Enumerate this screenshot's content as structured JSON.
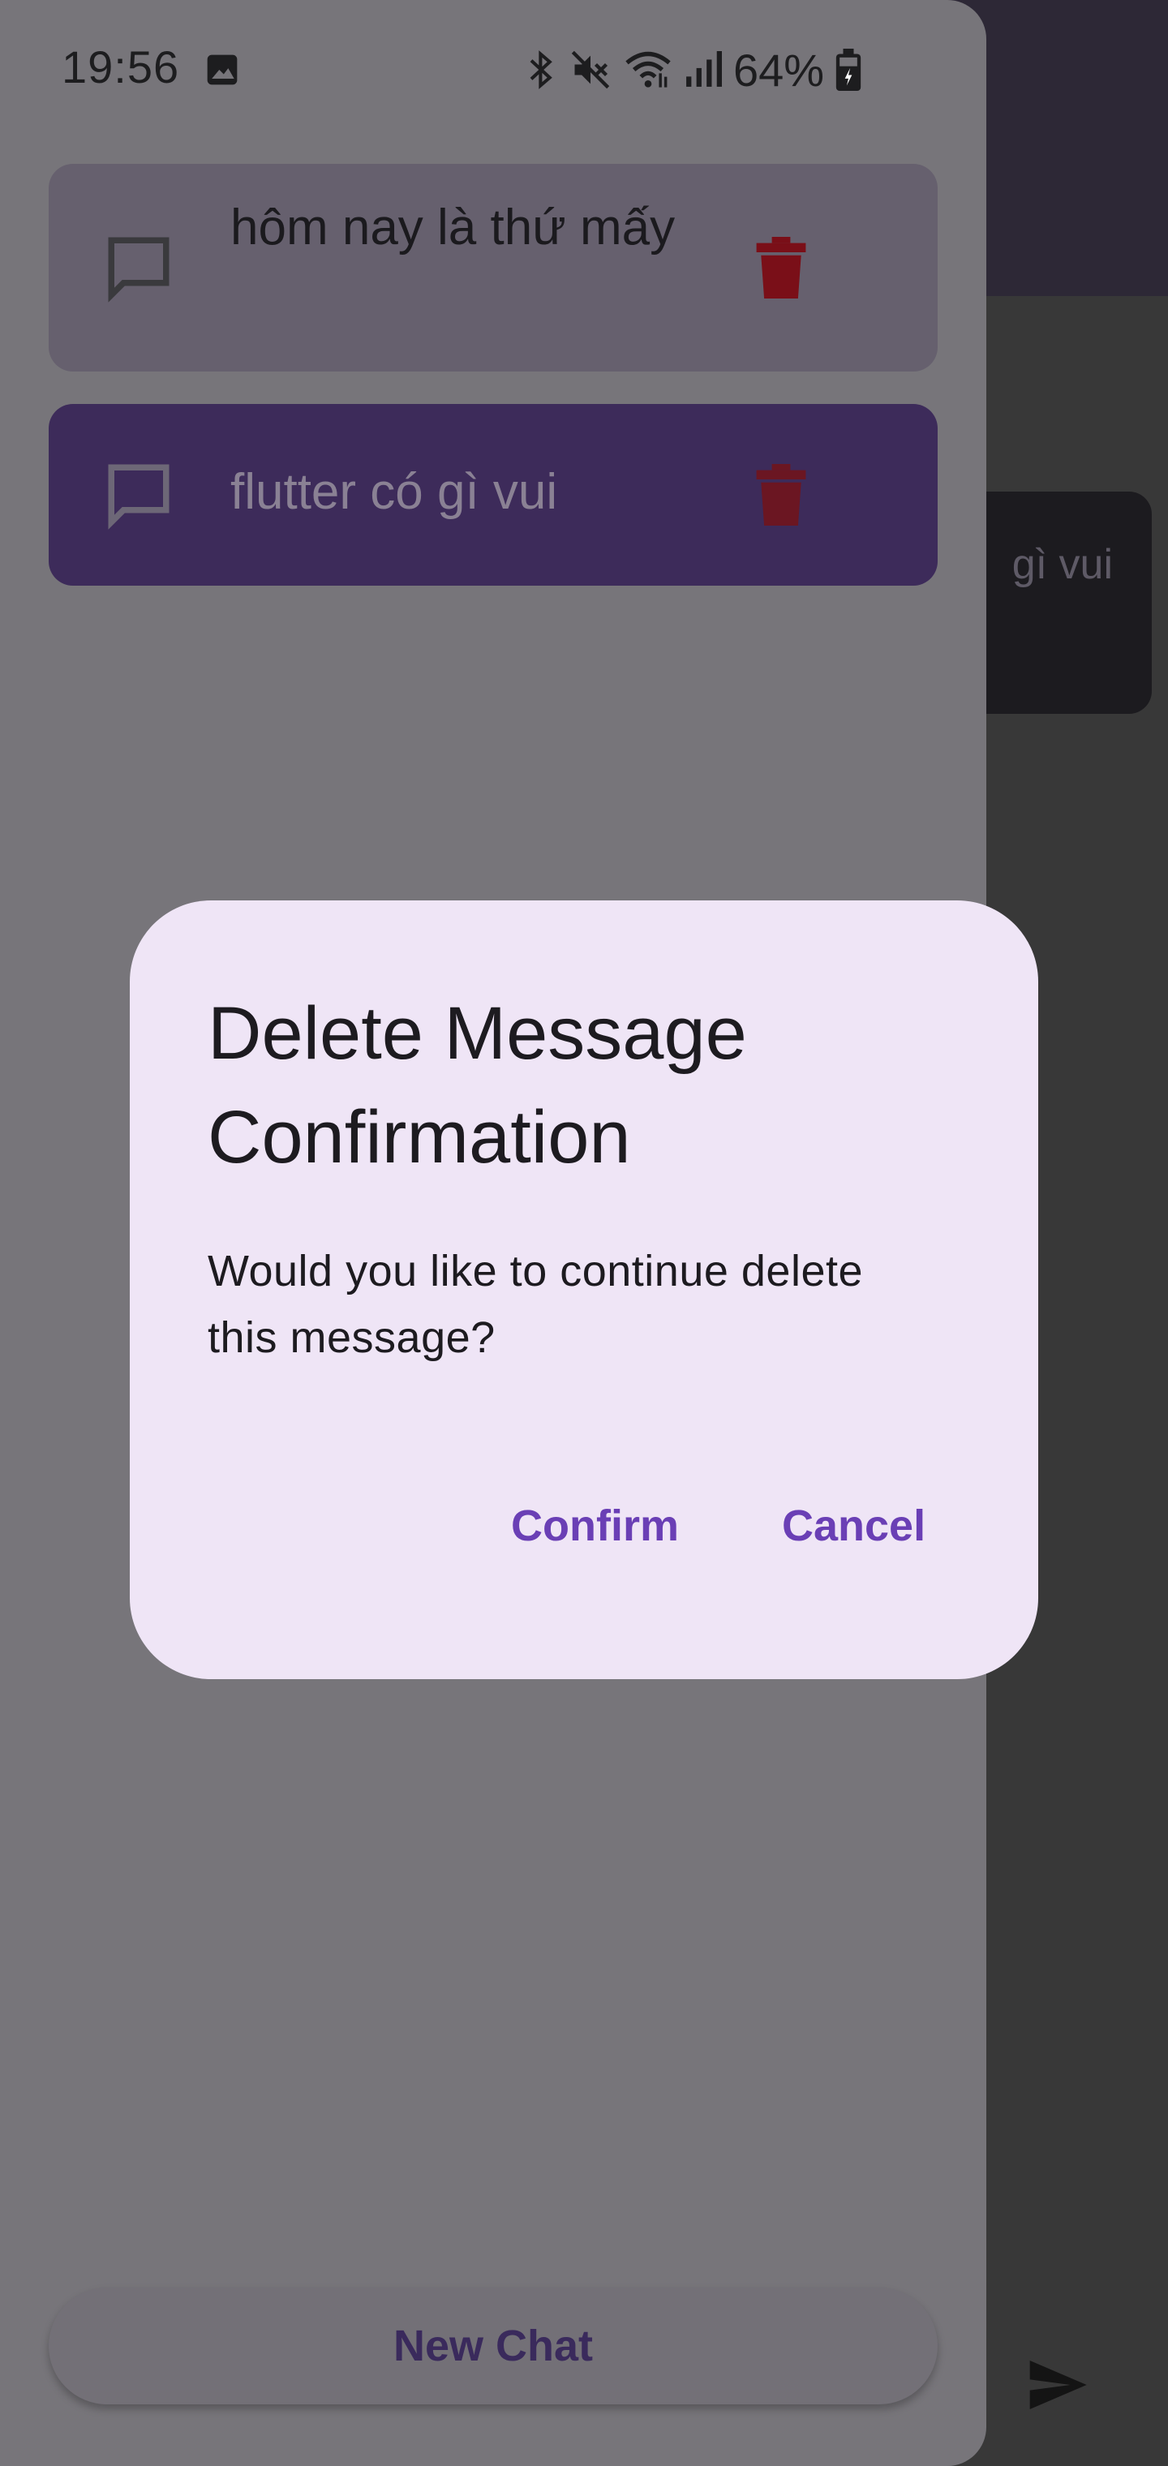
{
  "status_bar": {
    "time": "19:56",
    "battery": "64%",
    "icons": [
      "photo-icon",
      "bluetooth-icon",
      "mute-icon",
      "wifi-icon",
      "signal-icon",
      "battery-icon"
    ]
  },
  "drawer": {
    "chats": [
      {
        "label": "hôm nay là thứ mấy",
        "icon": "chat-bubble-icon",
        "action_icon": "trash-icon"
      },
      {
        "label": "flutter có gì vui",
        "icon": "chat-bubble-icon",
        "action_icon": "trash-icon"
      }
    ],
    "new_chat_label": "New Chat"
  },
  "background": {
    "bubble_text": "gì vui",
    "send_icon": "send-icon"
  },
  "dialog": {
    "title": "Delete Message Confirmation",
    "body": "Would you like to continue delete this message?",
    "confirm_label": "Confirm",
    "cancel_label": "Cancel"
  },
  "colors": {
    "accent": "#6a3fb5",
    "dialog_bg": "#efe5f6",
    "trash": "#7a0f18",
    "selected_chat": "#3d2b5a"
  }
}
